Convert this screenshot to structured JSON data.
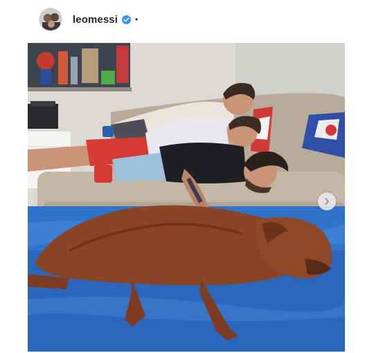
{
  "post": {
    "username": "leomessi",
    "separator": "•",
    "verified": true
  },
  "photo": {
    "carousel": true
  },
  "icons": {
    "avatar": "profile-avatar",
    "verified": "verified-badge-icon",
    "next": "chevron-right-icon"
  },
  "colors": {
    "verified": "#3897f0",
    "username": "#262626",
    "rug": "#2a6fc9",
    "sofa": "#b8aa98",
    "dog": "#8a4426"
  }
}
